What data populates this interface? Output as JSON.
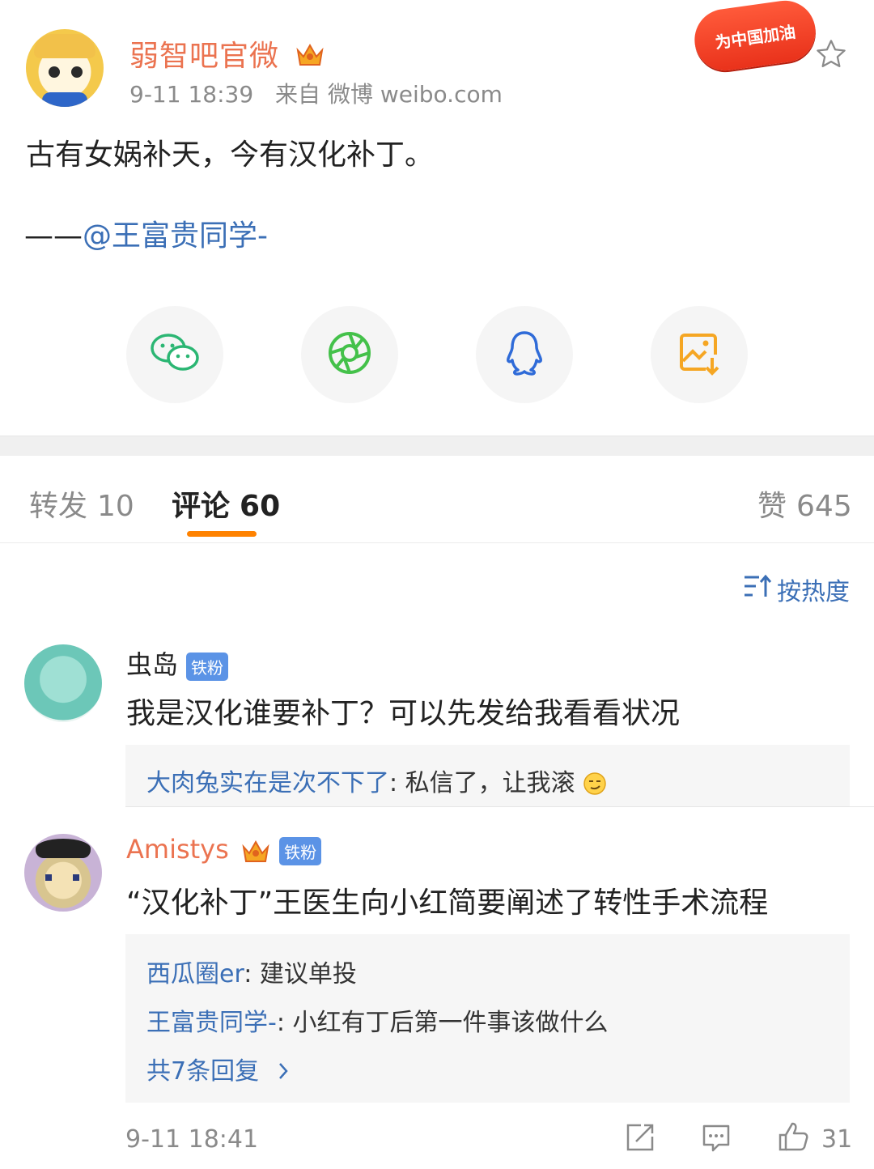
{
  "post": {
    "author": "弱智吧官微",
    "time": "9-11 18:39",
    "source": "来自 微博 weibo.com",
    "badge": "为中国加油",
    "text": "古有女娲补天，今有汉化补丁。",
    "signature_prefix": "——",
    "signature_mention": "@王富贵同学-"
  },
  "share": {
    "items": [
      "wechat-icon",
      "moments-icon",
      "qq-icon",
      "save-image-icon"
    ]
  },
  "tabs": {
    "repost_label": "转发",
    "repost_count": "10",
    "comment_label": "评论",
    "comment_count": "60",
    "like_label": "赞",
    "like_count": "645"
  },
  "sort": {
    "label": "按热度"
  },
  "comments": [
    {
      "name": "虫岛",
      "tag": "铁粉",
      "text": "我是汉化谁要补丁？可以先发给我看看状况",
      "replies": [
        {
          "user": "大肉兔实在是次不下了",
          "sep": ": ",
          "text": "私信了，让我滚"
        }
      ]
    },
    {
      "name": "Amistys",
      "tag": "铁粉",
      "text": "“汉化补丁”王医生向小红简要阐述了转性手术流程",
      "replies": [
        {
          "user": "西瓜圈er",
          "sep": ": ",
          "text": "建议单投"
        },
        {
          "user": "王富贵同学-",
          "sep": ": ",
          "text": "小红有丁后第一件事该做什么"
        }
      ],
      "more": "共7条回复",
      "more_icon": "chevron-right-icon",
      "time": "9-11 18:41",
      "likes": "31"
    }
  ],
  "colors": {
    "accent_orange": "#eb7350",
    "link_blue": "#3b6fb6",
    "tab_underline": "#ff8200"
  }
}
